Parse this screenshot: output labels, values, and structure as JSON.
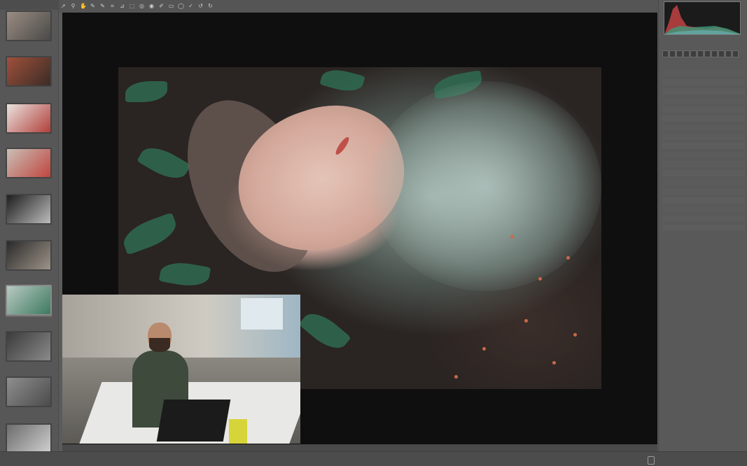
{
  "filmstrip": {
    "thumbnails": [
      {
        "colors": [
          "#9a8c82",
          "#4a4a48"
        ]
      },
      {
        "colors": [
          "#a0503a",
          "#3a2c26"
        ]
      },
      {
        "colors": [
          "#e9e2de",
          "#b23f3a"
        ]
      },
      {
        "colors": [
          "#c9bfb7",
          "#c0463e"
        ]
      },
      {
        "colors": [
          "#1e1e1e",
          "#bcbcbc"
        ]
      },
      {
        "colors": [
          "#2a2a2a",
          "#9d9388"
        ]
      },
      {
        "colors": [
          "#b8c9c2",
          "#3d7a60"
        ]
      },
      {
        "colors": [
          "#3b3b3b",
          "#8a8a8a"
        ]
      },
      {
        "colors": [
          "#8e8e8e",
          "#4b4b4b"
        ]
      },
      {
        "colors": [
          "#6c6c6c",
          "#cfcfcf"
        ]
      }
    ]
  },
  "toolbar": {
    "tools": [
      "pointer-icon",
      "zoom-icon",
      "hand-icon",
      "eyedropper-icon",
      "color-sampler-icon",
      "crop-icon",
      "straighten-icon",
      "transform-icon",
      "spot-removal-icon",
      "red-eye-icon",
      "adjustment-brush-icon",
      "graduated-filter-icon",
      "radial-filter-icon",
      "preferences-icon",
      "rotate-left-icon",
      "rotate-right-icon"
    ]
  },
  "viewer": {
    "photo_colors": {
      "leaf": "#2f6b50",
      "skin": "#d3a89a",
      "lips": "#c0504a"
    }
  },
  "right_panel": {
    "colors": {
      "histogram_bg": "#1b1b1b",
      "red": "#c44",
      "green": "#3c9a7a",
      "blue": "#6aa"
    }
  },
  "colors": {
    "app_bg": "#5b5b5b",
    "viewer_bg": "#0f0f0f"
  }
}
